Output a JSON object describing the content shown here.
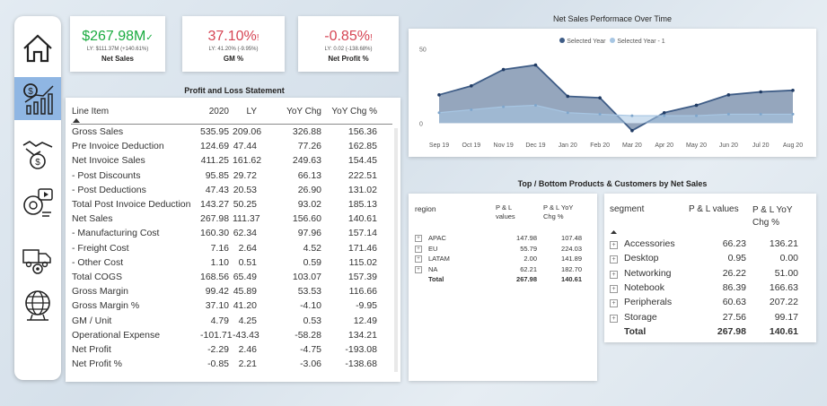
{
  "kpis": [
    {
      "value": "$267.98M",
      "mark": "✓",
      "ly": "LY: $111.37M (+140.61%)",
      "label": "Net Sales",
      "color": "#1aab40"
    },
    {
      "value": "37.10%",
      "mark": "!",
      "ly": "LY: 41.20% (-9.95%)",
      "label": "GM %",
      "color": "#d64554"
    },
    {
      "value": "-0.85%",
      "mark": "!",
      "ly": "LY: 0.02 (-138.68%)",
      "label": "Net Profit %",
      "color": "#d64554"
    }
  ],
  "nav": [
    {
      "icon": "home-icon"
    },
    {
      "icon": "finance-chart-icon"
    },
    {
      "icon": "sales-handshake-icon"
    },
    {
      "icon": "marketing-icon"
    },
    {
      "icon": "supply-chain-icon"
    },
    {
      "icon": "executive-globe-icon"
    }
  ],
  "pl": {
    "title": "Profit and Loss Statement",
    "headers": [
      "Line Item",
      "2020",
      "LY",
      "YoY Chg",
      "YoY Chg %"
    ],
    "rows": [
      [
        "Gross Sales",
        "535.95",
        "209.06",
        "326.88",
        "156.36"
      ],
      [
        "Pre Invoice Deduction",
        "124.69",
        "47.44",
        "77.26",
        "162.85"
      ],
      [
        "Net Invoice Sales",
        "411.25",
        "161.62",
        "249.63",
        "154.45"
      ],
      [
        "- Post Discounts",
        "95.85",
        "29.72",
        "66.13",
        "222.51"
      ],
      [
        "- Post Deductions",
        "47.43",
        "20.53",
        "26.90",
        "131.02"
      ],
      [
        "Total Post Invoice Deduction",
        "143.27",
        "50.25",
        "93.02",
        "185.13"
      ],
      [
        "Net Sales",
        "267.98",
        "111.37",
        "156.60",
        "140.61"
      ],
      [
        "- Manufacturing Cost",
        "160.30",
        "62.34",
        "97.96",
        "157.14"
      ],
      [
        "- Freight Cost",
        "7.16",
        "2.64",
        "4.52",
        "171.46"
      ],
      [
        "- Other Cost",
        "1.10",
        "0.51",
        "0.59",
        "115.02"
      ],
      [
        "Total COGS",
        "168.56",
        "65.49",
        "103.07",
        "157.39"
      ],
      [
        "Gross Margin",
        "99.42",
        "45.89",
        "53.53",
        "116.66"
      ],
      [
        "Gross Margin %",
        "37.10",
        "41.20",
        "-4.10",
        "-9.95"
      ],
      [
        "GM / Unit",
        "4.79",
        "4.25",
        "0.53",
        "12.49"
      ],
      [
        "Operational Expense",
        "-101.71",
        "-43.43",
        "-58.28",
        "134.21"
      ],
      [
        "Net Profit",
        "-2.29",
        "2.46",
        "-4.75",
        "-193.08"
      ],
      [
        "Net Profit %",
        "-0.85",
        "2.21",
        "-3.06",
        "-138.68"
      ]
    ]
  },
  "chart_data": {
    "type": "area",
    "title": "Net Sales Performace Over Time",
    "legend": [
      "Selected Year",
      "Selected Year - 1"
    ],
    "legend_position": "top",
    "x": [
      "Sep 19",
      "Oct 19",
      "Nov 19",
      "Dec 19",
      "Jan 20",
      "Feb 20",
      "Mar 20",
      "Apr 20",
      "May 20",
      "Jun 20",
      "Jul 20",
      "Aug 20"
    ],
    "yticks": [
      0,
      50
    ],
    "series": [
      {
        "name": "Selected Year",
        "values": [
          19,
          25,
          36,
          39,
          18,
          17,
          -5,
          7,
          12,
          19,
          21,
          22
        ],
        "color": "#3e5c86"
      },
      {
        "name": "Selected Year - 1",
        "values": [
          7,
          9,
          11,
          12,
          7,
          6,
          5,
          5,
          5,
          6,
          6,
          6
        ],
        "color": "#a7c6e3"
      }
    ],
    "ylim": [
      -10,
      55
    ],
    "grid": false
  },
  "tb": {
    "title": "Top / Bottom Products & Customers by Net Sales",
    "region": {
      "headers": [
        "region",
        "P & L values",
        "P & L YoY Chg %"
      ],
      "rows": [
        [
          "APAC",
          "147.98",
          "107.48"
        ],
        [
          "EU",
          "55.79",
          "224.03"
        ],
        [
          "LATAM",
          "2.00",
          "141.89"
        ],
        [
          "NA",
          "62.21",
          "182.70"
        ]
      ],
      "total": [
        "Total",
        "267.98",
        "140.61"
      ]
    },
    "segment": {
      "headers": [
        "segment",
        "P & L values",
        "P & L YoY Chg %"
      ],
      "rows": [
        [
          "Accessories",
          "66.23",
          "136.21"
        ],
        [
          "Desktop",
          "0.95",
          "0.00"
        ],
        [
          "Networking",
          "26.22",
          "51.00"
        ],
        [
          "Notebook",
          "86.39",
          "166.63"
        ],
        [
          "Peripherals",
          "60.63",
          "207.22"
        ],
        [
          "Storage",
          "27.56",
          "99.17"
        ]
      ],
      "total": [
        "Total",
        "267.98",
        "140.61"
      ]
    }
  }
}
